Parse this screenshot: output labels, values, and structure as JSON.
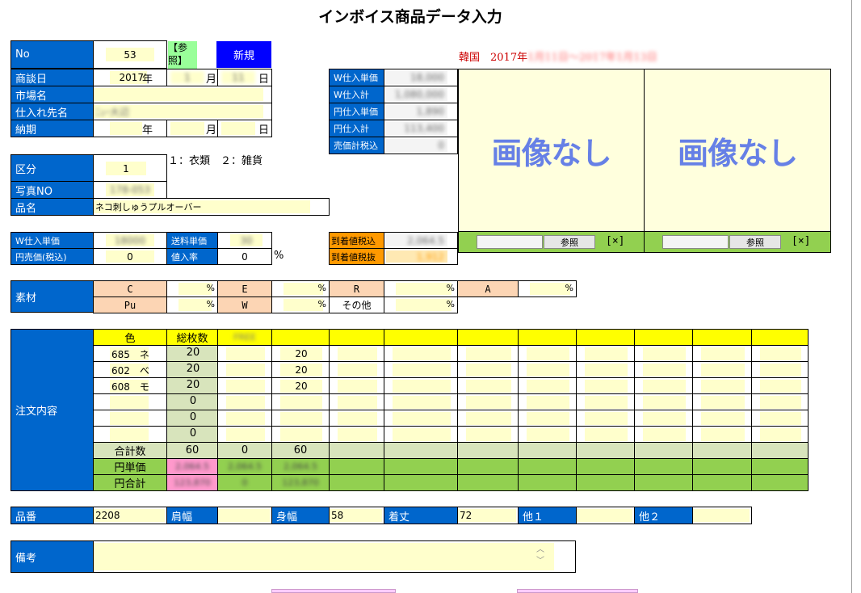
{
  "title": "インボイス商品データ入力",
  "header": {
    "no_label": "No",
    "no_value": "53",
    "ref_button": "【参照】",
    "new_button": "新規",
    "korea_label": "韓国　2017年",
    "korea_range": "1月11日～2017年1月13日",
    "tilde": "～"
  },
  "meeting_date": {
    "label": "商談日",
    "year": "2017",
    "year_unit": "年",
    "month": "1",
    "month_unit": "月",
    "day": "11",
    "day_unit": "日"
  },
  "market_name": {
    "label": "市場名",
    "value": ""
  },
  "supplier": {
    "label": "仕入れ先名",
    "value": "ﾆｭｰ大辺"
  },
  "delivery": {
    "label": "納期",
    "year_unit": "年",
    "month_unit": "月",
    "day_unit": "日"
  },
  "category": {
    "label": "区分",
    "value": "1",
    "hint": "１：衣類　２：雑貨"
  },
  "photo_no": {
    "label": "写真NO",
    "value": "178-053"
  },
  "product_name": {
    "label": "品名",
    "value": "ネコ刺しゅうプルオーバー"
  },
  "prices_panel": {
    "w_unit_label": "W仕入単価",
    "w_unit_value": "18,000",
    "w_total_label": "W仕入計",
    "w_total_value": "1,080,000",
    "yen_unit_label": "円仕入単価",
    "yen_unit_value": "1,890",
    "yen_total_label": "円仕入計",
    "yen_total_value": "113,400",
    "sales_tax_label": "売価計税込",
    "sales_tax_value": "0"
  },
  "images": {
    "left_text": "画像なし",
    "right_text": "画像なし",
    "browse_label": "参照",
    "clear_label": "[×]"
  },
  "cost": {
    "w_unit_label": "W仕入単価",
    "w_unit_value": "18000",
    "shipping_label": "送料単価",
    "shipping_value": "30",
    "yen_price_label": "円売価(税込)",
    "yen_price_value": "0",
    "markup_label": "値入率",
    "markup_value": "0",
    "percent": "%",
    "arrival_tax_in_label": "到着値税込",
    "arrival_tax_in_value": "2,064.5",
    "arrival_tax_out_label": "到着値税抜",
    "arrival_tax_out_value": "1,912"
  },
  "material": {
    "label": "素材",
    "row1": [
      {
        "name": "C",
        "value": ""
      },
      {
        "name": "E",
        "value": ""
      },
      {
        "name": "R",
        "value": ""
      },
      {
        "name": "A",
        "value": ""
      }
    ],
    "row2": [
      {
        "name": "Pu",
        "value": ""
      },
      {
        "name": "W",
        "value": ""
      },
      {
        "name": "その他",
        "value": ""
      }
    ],
    "percent": "%"
  },
  "order": {
    "label": "注文内容",
    "color_header": "色",
    "total_header": "総枚数",
    "size_header": "FREE",
    "rows": [
      {
        "color": "685　ネ",
        "total": "20",
        "s1": "",
        "s2": "20"
      },
      {
        "color": "602　ベ",
        "total": "20",
        "s1": "",
        "s2": "20"
      },
      {
        "color": "608　モ",
        "total": "20",
        "s1": "",
        "s2": "20"
      },
      {
        "color": "",
        "total": "0",
        "s1": "",
        "s2": ""
      },
      {
        "color": "",
        "total": "0",
        "s1": "",
        "s2": ""
      },
      {
        "color": "",
        "total": "0",
        "s1": "",
        "s2": ""
      }
    ],
    "sum_label": "合計数",
    "sum_total": "60",
    "sum_s1": "0",
    "sum_s2": "60",
    "unit_label": "円単価",
    "unit_v1": "2,064.5",
    "unit_v2": "2,064.5",
    "unit_v3": "2,064.5",
    "amount_label": "円合計",
    "amount_v1": "123,870",
    "amount_v2": "0",
    "amount_v3": "123,870"
  },
  "spec": {
    "part_label": "品番",
    "part_value": "2208",
    "shoulder_label": "肩幅",
    "shoulder_value": "",
    "body_label": "身幅",
    "body_value": "58",
    "length_label": "着丈",
    "length_value": "72",
    "other1_label": "他１",
    "other1_value": "",
    "other2_label": "他２",
    "other2_value": ""
  },
  "notes": {
    "label": "備考",
    "value": ""
  },
  "colors": {
    "blue": "#0066cc",
    "yellow_input": "#ffffcc",
    "header_yellow": "#ffff00",
    "green": "#92d050",
    "orange": "#ff9900",
    "peach": "#fcd5b4",
    "red_text": "#cc0000"
  }
}
